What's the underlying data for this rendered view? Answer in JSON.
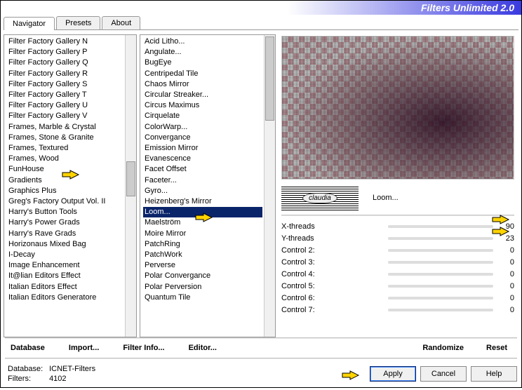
{
  "title": "Filters Unlimited 2.0",
  "tabs": [
    "Navigator",
    "Presets",
    "About"
  ],
  "categories": {
    "items": [
      "Filter Factory Gallery N",
      "Filter Factory Gallery P",
      "Filter Factory Gallery Q",
      "Filter Factory Gallery R",
      "Filter Factory Gallery S",
      "Filter Factory Gallery T",
      "Filter Factory Gallery U",
      "Filter Factory Gallery V",
      "Frames, Marble & Crystal",
      "Frames, Stone & Granite",
      "Frames, Textured",
      "Frames, Wood",
      "FunHouse",
      "Gradients",
      "Graphics Plus",
      "Greg's Factory Output Vol. II",
      "Harry's Button Tools",
      "Harry's Power Grads",
      "Harry's Rave Grads",
      "Horizonaus Mixed Bag",
      "I-Decay",
      "Image Enhancement",
      "It@lian Editors Effect",
      "Italian Editors Effect",
      "Italian Editors Generatore"
    ],
    "selected_index": -1
  },
  "filters": {
    "items": [
      "Acid Litho...",
      "Angulate...",
      "BugEye",
      "Centripedal Tile",
      "Chaos Mirror",
      "Circular Streaker...",
      "Circus Maximus",
      "Cirquelate",
      "ColorWarp...",
      "Convergance",
      "Emission Mirror",
      "Evanescence",
      "Facet Offset",
      "Faceter...",
      "Gyro...",
      "Heizenberg's Mirror",
      "Loom...",
      "Maelström",
      "Moire Mirror",
      "PatchRing",
      "PatchWork",
      "Perverse",
      "Polar Convergance",
      "Polar Perversion",
      "Quantum Tile"
    ],
    "selected_index": 16
  },
  "logo_text": "claudia",
  "current_filter": "Loom...",
  "controls": [
    {
      "label": "X-threads",
      "value": 90
    },
    {
      "label": "Y-threads",
      "value": 23
    },
    {
      "label": "Control 2:",
      "value": 0
    },
    {
      "label": "Control 3:",
      "value": 0
    },
    {
      "label": "Control 4:",
      "value": 0
    },
    {
      "label": "Control 5:",
      "value": 0
    },
    {
      "label": "Control 6:",
      "value": 0
    },
    {
      "label": "Control 7:",
      "value": 0
    }
  ],
  "linkbar_left": [
    "Database",
    "Import...",
    "Filter Info...",
    "Editor..."
  ],
  "linkbar_right": [
    "Randomize",
    "Reset"
  ],
  "status": {
    "db_label": "Database:",
    "db_value": "ICNET-Filters",
    "filters_label": "Filters:",
    "filters_value": "4102"
  },
  "buttons": {
    "apply": "Apply",
    "cancel": "Cancel",
    "help": "Help"
  }
}
